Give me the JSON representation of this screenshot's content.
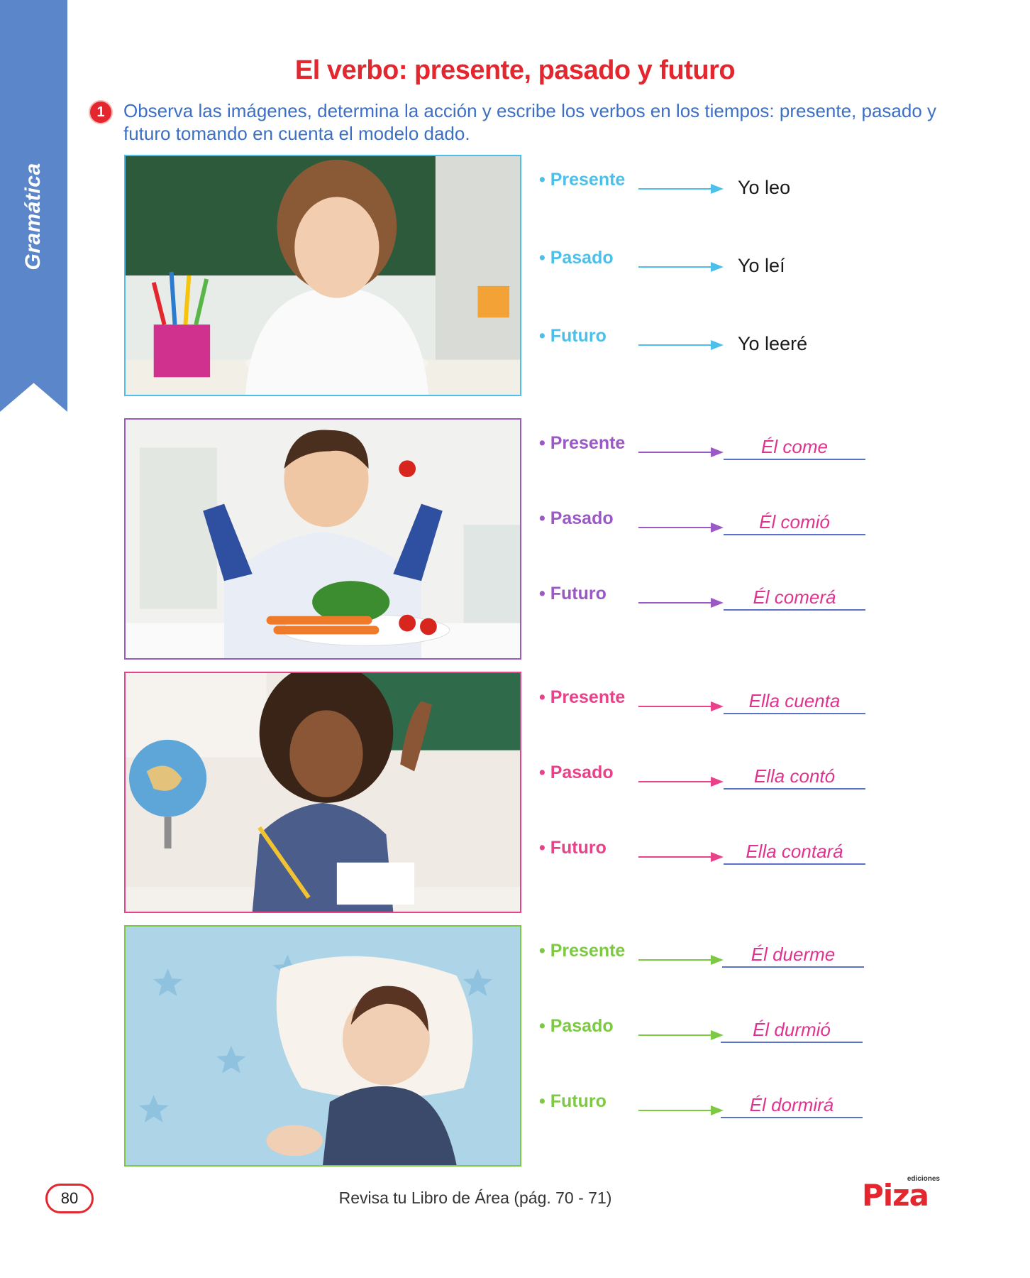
{
  "sidebar": {
    "label": "Gramática",
    "color": "#5b86c9"
  },
  "title": "El verbo: presente, pasado y futuro",
  "question": {
    "number": "1",
    "text": "Observa las imágenes, determina la acción y escribe los verbos en los tiempos: presente, pasado y futuro tomando en cuenta el modelo dado."
  },
  "exercises": [
    {
      "color": "#4cc0ea",
      "image": "girl-reading-photo",
      "rows": [
        {
          "label": "• Presente",
          "answer": "Yo leo"
        },
        {
          "label": "• Pasado",
          "answer": "Yo leí"
        },
        {
          "label": "• Futuro",
          "answer": "Yo leeré"
        }
      ]
    },
    {
      "color": "#9b59c6",
      "image": "boy-eating-vegetables-photo",
      "rows": [
        {
          "label": "• Presente",
          "answer": "Él come"
        },
        {
          "label": "• Pasado",
          "answer": "Él comió"
        },
        {
          "label": "• Futuro",
          "answer": "Él comerá"
        }
      ]
    },
    {
      "color": "#e9428a",
      "image": "girl-counting-photo",
      "rows": [
        {
          "label": "• Presente",
          "answer": "Ella cuenta"
        },
        {
          "label": "• Pasado",
          "answer": "Ella contó"
        },
        {
          "label": "• Futuro",
          "answer": "Ella contará"
        }
      ]
    },
    {
      "color": "#7dc943",
      "image": "boy-sleeping-photo",
      "rows": [
        {
          "label": "• Presente",
          "answer": "Él duerme"
        },
        {
          "label": "• Pasado",
          "answer": "Él durmió"
        },
        {
          "label": "• Futuro",
          "answer": "Él dormirá"
        }
      ]
    }
  ],
  "footer": {
    "page_number": "80",
    "reference": "Revisa tu Libro de Área (pág. 70 - 71)",
    "logo_small": "ediciones",
    "logo_text": "Piza"
  }
}
